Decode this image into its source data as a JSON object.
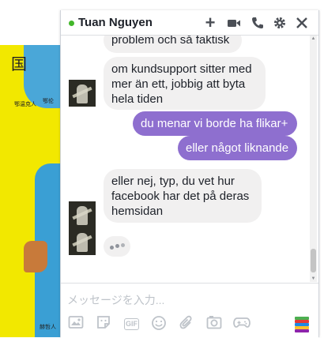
{
  "background": {
    "map_glyphs": [
      "国",
      "鄂温克人",
      "鄂伦",
      "赫哲人"
    ]
  },
  "chat": {
    "contact_name": "Tuan Nguyen",
    "status": "online",
    "header_icons": [
      "plus-icon",
      "video-camera-icon",
      "phone-icon",
      "gear-icon",
      "close-icon"
    ],
    "messages": [
      {
        "from": "them",
        "text": "problem och så faktisk"
      },
      {
        "from": "them",
        "text": "om kundsupport sitter med mer än ett, jobbig att byta hela tiden"
      },
      {
        "from": "me",
        "text": "du menar vi borde ha flikar+"
      },
      {
        "from": "me",
        "text": "eller något liknande"
      },
      {
        "from": "them",
        "text": "eller nej, typ, du vet hur facebook har det på deras hemsidan"
      }
    ],
    "typing_indicator": true,
    "composer": {
      "placeholder": "メッセージを入力...",
      "value": "",
      "tools": [
        "photo-icon",
        "sticker-icon",
        "gif-icon",
        "emoji-icon",
        "attachment-icon",
        "camera-icon",
        "game-controller-icon",
        "sticker-stack-icon"
      ],
      "gif_label": "GIF"
    },
    "colors": {
      "outgoing_bubble": "#8e6fcf",
      "incoming_bubble": "#f1f0f0",
      "online_dot": "#42b72a"
    }
  }
}
